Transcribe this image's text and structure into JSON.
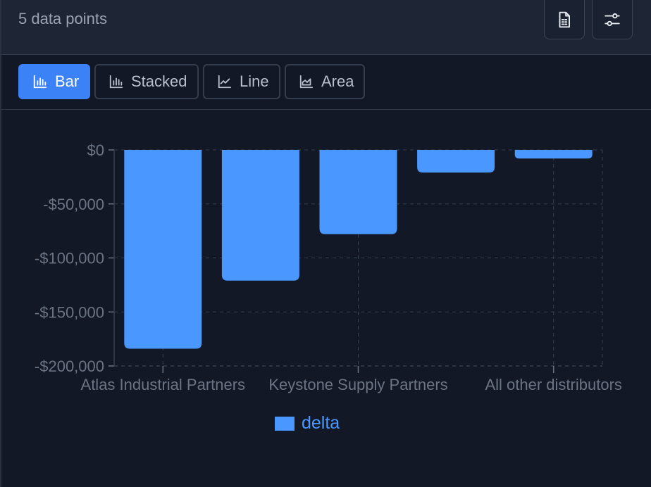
{
  "header": {
    "count_text": "5 data points"
  },
  "header_buttons": [
    {
      "name": "export-csv-button",
      "icon": "document-grid-icon"
    },
    {
      "name": "chart-settings-button",
      "icon": "sliders-icon"
    }
  ],
  "tabs": [
    {
      "label": "Bar",
      "icon": "bar-chart-icon",
      "active": true
    },
    {
      "label": "Stacked",
      "icon": "bar-chart-icon",
      "active": false
    },
    {
      "label": "Line",
      "icon": "line-chart-icon",
      "active": false
    },
    {
      "label": "Area",
      "icon": "area-chart-icon",
      "active": false
    }
  ],
  "colors": {
    "bar": "#4a97ff",
    "active_tab": "#3b82f6",
    "axis_text": "#6b7484",
    "grid": "#364152"
  },
  "chart_data": {
    "type": "bar",
    "categories": [
      "Atlas Industrial Partners",
      "",
      "Keystone Supply Partners",
      "",
      "All other distributors"
    ],
    "series": [
      {
        "name": "delta",
        "values": [
          -184000,
          -121000,
          -78000,
          -21000,
          -8000
        ]
      }
    ],
    "yticks": [
      "$0",
      "-$50,000",
      "-$100,000",
      "-$150,000",
      "-$200,000"
    ],
    "ylim": [
      -200000,
      0
    ],
    "grid": true,
    "legend": "bottom-center"
  }
}
